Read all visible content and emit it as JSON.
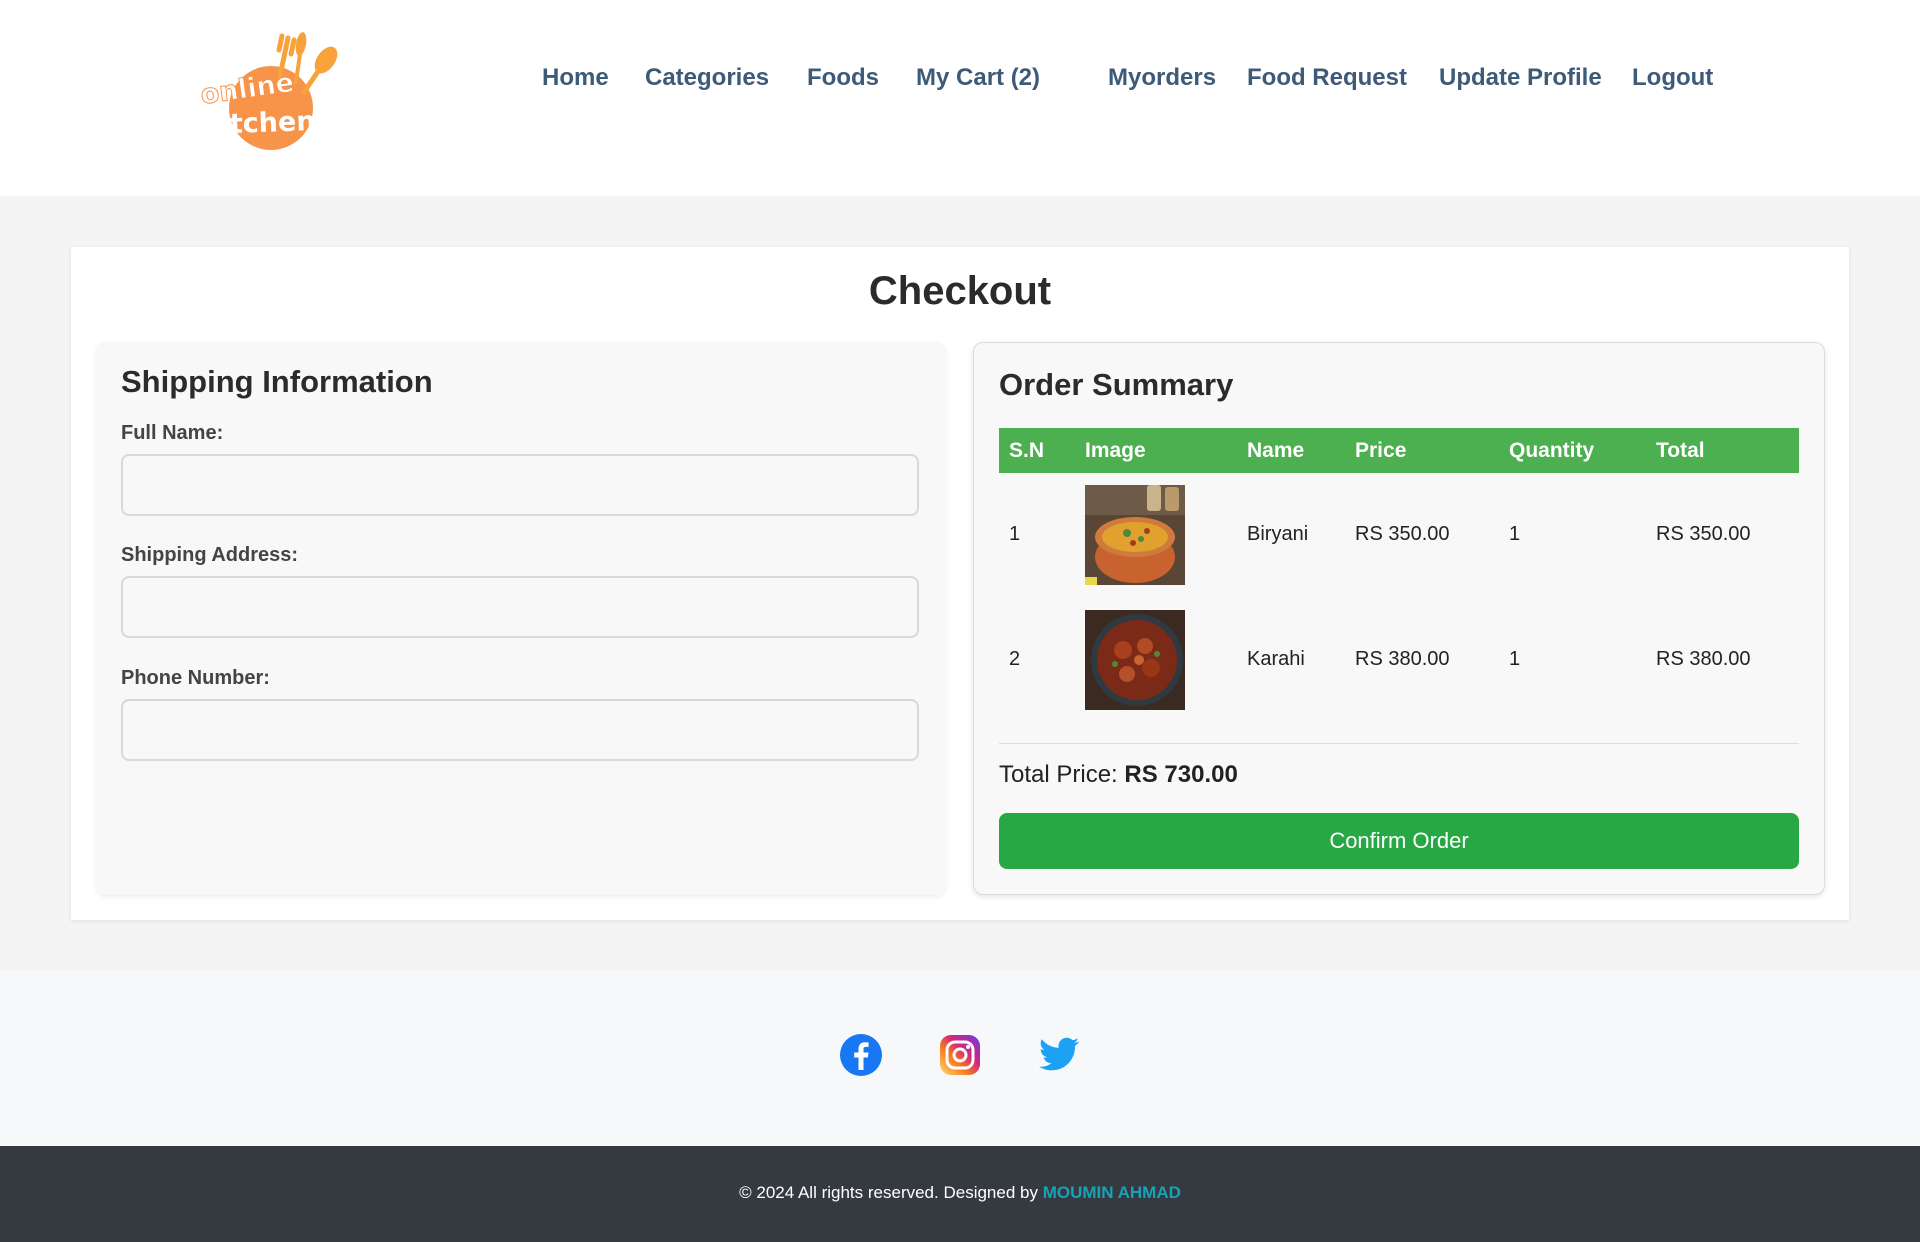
{
  "header": {
    "logo_text": [
      "online",
      "Kitchen"
    ],
    "nav": [
      {
        "label": "Home"
      },
      {
        "label": "Categories"
      },
      {
        "label": "Foods"
      },
      {
        "label": "My Cart (2)"
      },
      {
        "label": "Myorders"
      },
      {
        "label": "Food Request"
      },
      {
        "label": "Update Profile"
      },
      {
        "label": "Logout"
      }
    ]
  },
  "main": {
    "title": "Checkout",
    "shipping": {
      "title": "Shipping Information",
      "full_name_label": "Full Name:",
      "full_name_value": "",
      "address_label": "Shipping Address:",
      "address_value": "",
      "phone_label": "Phone Number:",
      "phone_value": ""
    },
    "summary": {
      "title": "Order Summary",
      "columns": [
        "S.N",
        "Image",
        "Name",
        "Price",
        "Quantity",
        "Total"
      ],
      "rows": [
        {
          "sn": "1",
          "image": "biryani-photo",
          "name": "Biryani",
          "price": "RS 350.00",
          "quantity": "1",
          "total": "RS 350.00"
        },
        {
          "sn": "2",
          "image": "karahi-photo",
          "name": "Karahi",
          "price": "RS 380.00",
          "quantity": "1",
          "total": "RS 380.00"
        }
      ],
      "total_label": "Total Price:",
      "total_value": "RS 730.00",
      "confirm_label": "Confirm Order"
    }
  },
  "social": {
    "icons": [
      "facebook-icon",
      "instagram-icon",
      "twitter-icon"
    ]
  },
  "footer": {
    "text": "© 2024 All rights reserved. Designed by",
    "designer": "MOUMIN AHMAD"
  },
  "colors": {
    "brand_orange": "#f7944a",
    "nav_text": "#3d5a78",
    "table_header": "#4caf50",
    "confirm_button": "#28a745",
    "footer_bg": "#343a40",
    "footer_link": "#17a2b8"
  }
}
